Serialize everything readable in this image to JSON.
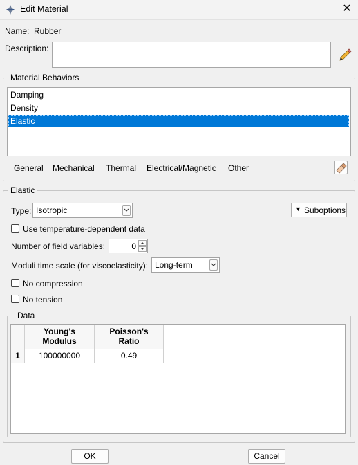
{
  "window": {
    "title": "Edit Material",
    "icon": "abaqus-material-icon",
    "close_icon": "close-icon"
  },
  "name": {
    "label": "Name:",
    "value": "Rubber"
  },
  "description": {
    "label": "Description:",
    "value": "",
    "edit_icon": "pencil-icon"
  },
  "behaviors": {
    "title": "Material Behaviors",
    "items": [
      {
        "label": "Damping",
        "selected": false
      },
      {
        "label": "Density",
        "selected": false
      },
      {
        "label": "Elastic",
        "selected": true
      }
    ],
    "menu": [
      {
        "mnemonic": "G",
        "rest": "eneral"
      },
      {
        "mnemonic": "M",
        "rest": "echanical"
      },
      {
        "mnemonic": "T",
        "rest": "hermal"
      },
      {
        "mnemonic": "E",
        "rest": "lectrical/Magnetic"
      },
      {
        "mnemonic": "O",
        "rest": "ther"
      }
    ],
    "delete_icon": "eraser-icon"
  },
  "elastic": {
    "title": "Elastic",
    "type_label": "Type:",
    "type_value": "Isotropic",
    "suboptions_label": "Suboptions",
    "temp_dependent_label": "Use temperature-dependent data",
    "temp_dependent_checked": false,
    "field_vars_label": "Number of field variables:",
    "field_vars_value": "0",
    "moduli_label": "Moduli time scale (for viscoelasticity):",
    "moduli_value": "Long-term",
    "no_compression_label": "No compression",
    "no_compression_checked": false,
    "no_tension_label": "No tension",
    "no_tension_checked": false
  },
  "data_table": {
    "title": "Data",
    "headers": [
      {
        "line1": "Young's",
        "line2": "Modulus"
      },
      {
        "line1": "Poisson's",
        "line2": "Ratio"
      }
    ],
    "rows": [
      {
        "index": "1",
        "cells": [
          "100000000",
          "0.49"
        ]
      }
    ]
  },
  "buttons": {
    "ok": "OK",
    "cancel": "Cancel"
  }
}
